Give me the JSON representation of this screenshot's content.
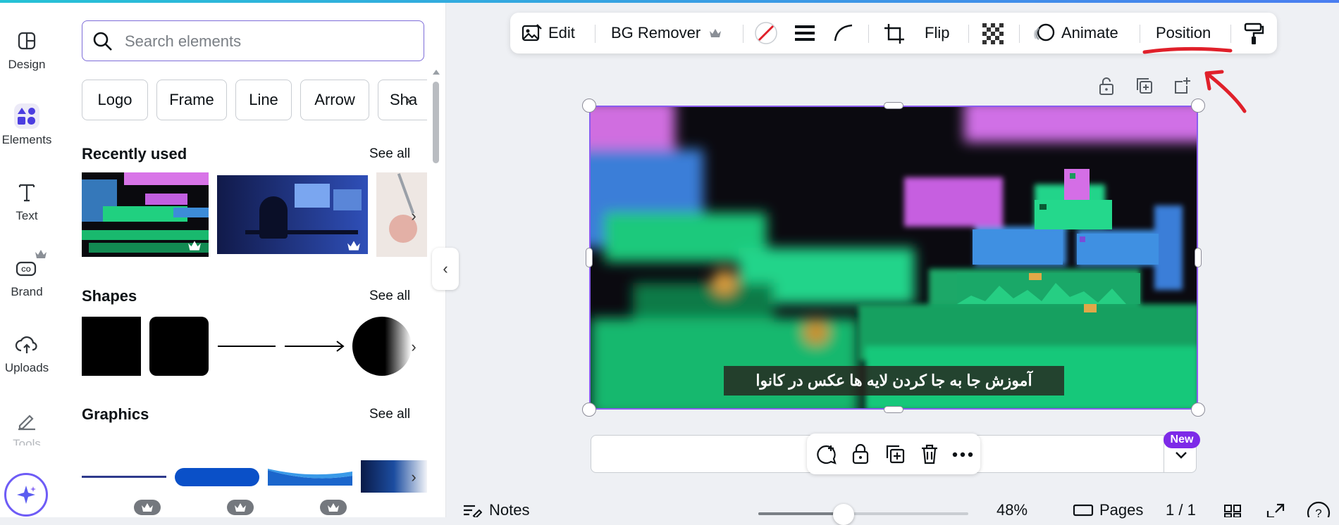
{
  "rail": {
    "items": [
      {
        "label": "Design"
      },
      {
        "label": "Elements"
      },
      {
        "label": "Text"
      },
      {
        "label": "Brand"
      },
      {
        "label": "Uploads"
      },
      {
        "label": "Tools"
      }
    ]
  },
  "panel": {
    "search_placeholder": "Search elements",
    "chips": [
      "Logo",
      "Frame",
      "Line",
      "Arrow",
      "Sha"
    ],
    "recent": {
      "title": "Recently used",
      "see_all": "See all"
    },
    "shapes": {
      "title": "Shapes",
      "see_all": "See all"
    },
    "graphics": {
      "title": "Graphics",
      "see_all": "See all"
    }
  },
  "toolbar": {
    "edit": "Edit",
    "bg_remover": "BG Remover",
    "flip": "Flip",
    "animate": "Animate",
    "position": "Position"
  },
  "canvas": {
    "caption": "آموزش جا به جا کردن لایه ها عکس در کانوا",
    "new_badge": "New"
  },
  "footer": {
    "notes": "Notes",
    "zoom": "48%",
    "pages": "Pages",
    "page_count": "1 / 1"
  },
  "colors": {
    "accent": "#7d2ae8",
    "annotation": "#e0202a",
    "selection": "#8a5cf0"
  }
}
